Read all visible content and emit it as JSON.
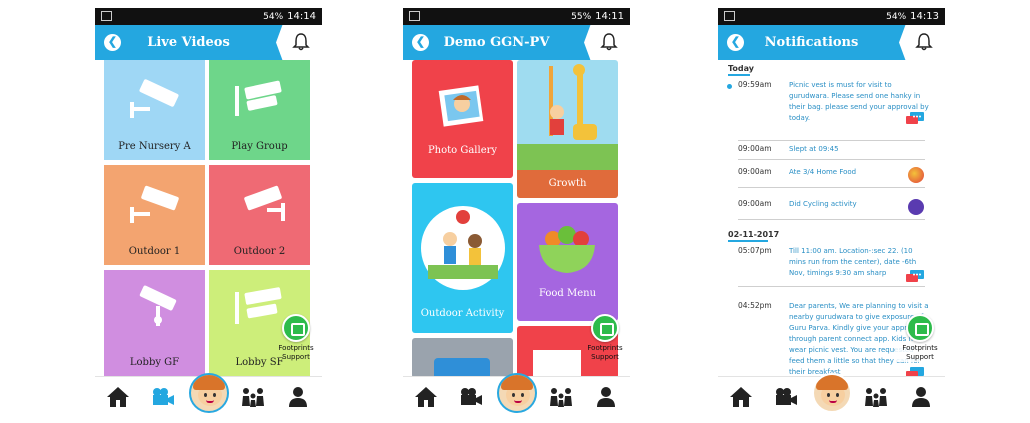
{
  "status": {
    "phone1": {
      "battery": "54%",
      "time": "14:14"
    },
    "phone2": {
      "battery": "55%",
      "time": "14:11"
    },
    "phone3": {
      "battery": "54%",
      "time": "14:13"
    }
  },
  "screens": {
    "live_videos": {
      "title": "Live Videos",
      "tiles": [
        {
          "label": "Pre Nursery A",
          "color": "#9fd7f5"
        },
        {
          "label": "Play Group",
          "color": "#6ed68a"
        },
        {
          "label": "Outdoor 1",
          "color": "#f3a470"
        },
        {
          "label": "Outdoor 2",
          "color": "#ef6a74"
        },
        {
          "label": "Lobby GF",
          "color": "#d08ee0"
        },
        {
          "label": "Lobby SF",
          "color": "#cdee7a"
        }
      ]
    },
    "demo": {
      "title": "Demo GGN-PV",
      "tiles": [
        {
          "label": "Photo Gallery",
          "color": "#f0424a"
        },
        {
          "label": "Growth",
          "color": "#e06b3b"
        },
        {
          "label": "Outdoor Activity",
          "color": "#2ec6f0"
        },
        {
          "label": "Food Menu",
          "color": "#a566e0"
        }
      ]
    },
    "notifications": {
      "title": "Notifications",
      "groups": [
        {
          "date": "Today",
          "items": [
            {
              "time": "09:59am",
              "text": "Picnic vest is must for visit to gurudwara. Please send one hanky in their bag. please send your approval by today."
            },
            {
              "time": "09:00am",
              "text": "Slept at 09:45"
            },
            {
              "time": "09:00am",
              "text": "Ate 3/4 Home Food"
            },
            {
              "time": "09:00am",
              "text": "Did Cycling activity"
            }
          ]
        },
        {
          "date": "02-11-2017",
          "items": [
            {
              "time": "05:07pm",
              "text": "Till 11:00 am. Location-:sec 22. (10 mins run from the center), date -6th Nov, timings 9:30 am sharp"
            },
            {
              "time": "04:52pm",
              "text": "Dear parents, We are planning to visit a nearby gurudwara to give exposure of Guru Parva. Kindly give your approv through parent connect app. Kids h wear picnic vest. You are requested feed them a little so that they can for their breakfast"
            }
          ]
        }
      ]
    }
  },
  "support": {
    "line1": "Footprints",
    "line2": "Support"
  },
  "nav": {
    "icons": [
      "home-icon",
      "video-camera-icon",
      "child-avatar",
      "parents-group-icon",
      "profile-icon"
    ],
    "active_color": "#24a7e0",
    "inactive_color": "#222222"
  }
}
